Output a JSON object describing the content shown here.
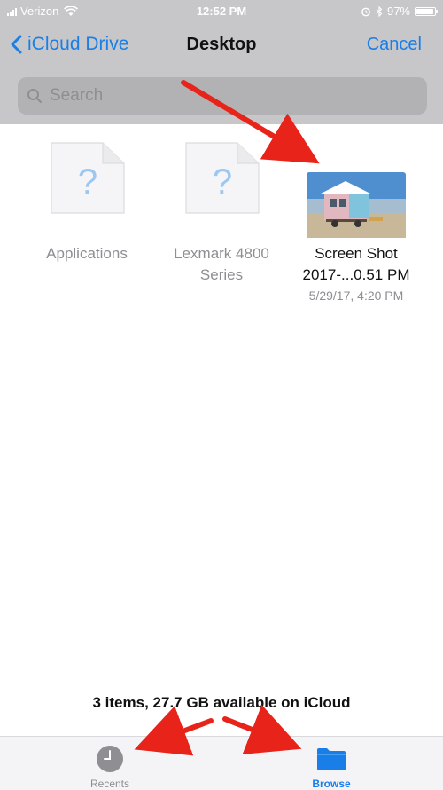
{
  "status_bar": {
    "carrier": "Verizon",
    "time": "12:52 PM",
    "battery": "97%",
    "battery_level": 0.97
  },
  "nav": {
    "back_label": "iCloud Drive",
    "title": "Desktop",
    "cancel_label": "Cancel"
  },
  "search": {
    "placeholder": "Search"
  },
  "files": [
    {
      "name": "Applications",
      "type": "unknown"
    },
    {
      "name": "Lexmark 4800 Series",
      "type": "unknown"
    },
    {
      "name": "Screen Shot 2017-...0.51 PM",
      "date": "5/29/17, 4:20 PM",
      "type": "image"
    }
  ],
  "footer": {
    "info": "3 items, 27.7 GB available on iCloud"
  },
  "tabs": [
    {
      "label": "Recents",
      "icon": "clock-icon",
      "selected": false
    },
    {
      "label": "Browse",
      "icon": "folder-icon",
      "selected": true
    }
  ],
  "colors": {
    "accent": "#1a7ee8",
    "annotation_arrow": "#e8231a",
    "top_area": "#c7c7c9"
  }
}
